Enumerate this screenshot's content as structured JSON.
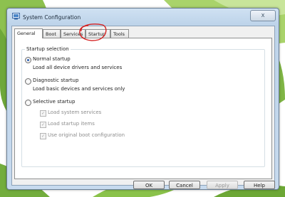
{
  "window": {
    "title": "System Configuration",
    "close_symbol": "X",
    "app_icon": "msconfig-icon"
  },
  "tabs": [
    {
      "label": "General",
      "active": true
    },
    {
      "label": "Boot"
    },
    {
      "label": "Services"
    },
    {
      "label": "Startup",
      "annotated": true
    },
    {
      "label": "Tools"
    }
  ],
  "startup_selection": {
    "title": "Startup selection",
    "options": [
      {
        "label": "Normal startup",
        "description": "Load all device drivers and services",
        "selected": true
      },
      {
        "label": "Diagnostic startup",
        "description": "Load basic devices and services only",
        "selected": false
      },
      {
        "label": "Selective startup",
        "selected": false
      }
    ],
    "selective_items": [
      {
        "label": "Load system services",
        "checked": true,
        "enabled": false
      },
      {
        "label": "Load startup items",
        "checked": true,
        "enabled": false
      },
      {
        "label": "Use original boot configuration",
        "checked": true,
        "enabled": false
      }
    ]
  },
  "buttons": {
    "ok": "OK",
    "cancel": "Cancel",
    "apply": "Apply",
    "help": "Help"
  },
  "annotation": {
    "shape": "red-ellipse",
    "target": "Startup",
    "color": "#d42020"
  },
  "colors": {
    "window_frame": "#bed4ea",
    "leaf_green": "#5f9a2c",
    "background": "#ffffff"
  }
}
